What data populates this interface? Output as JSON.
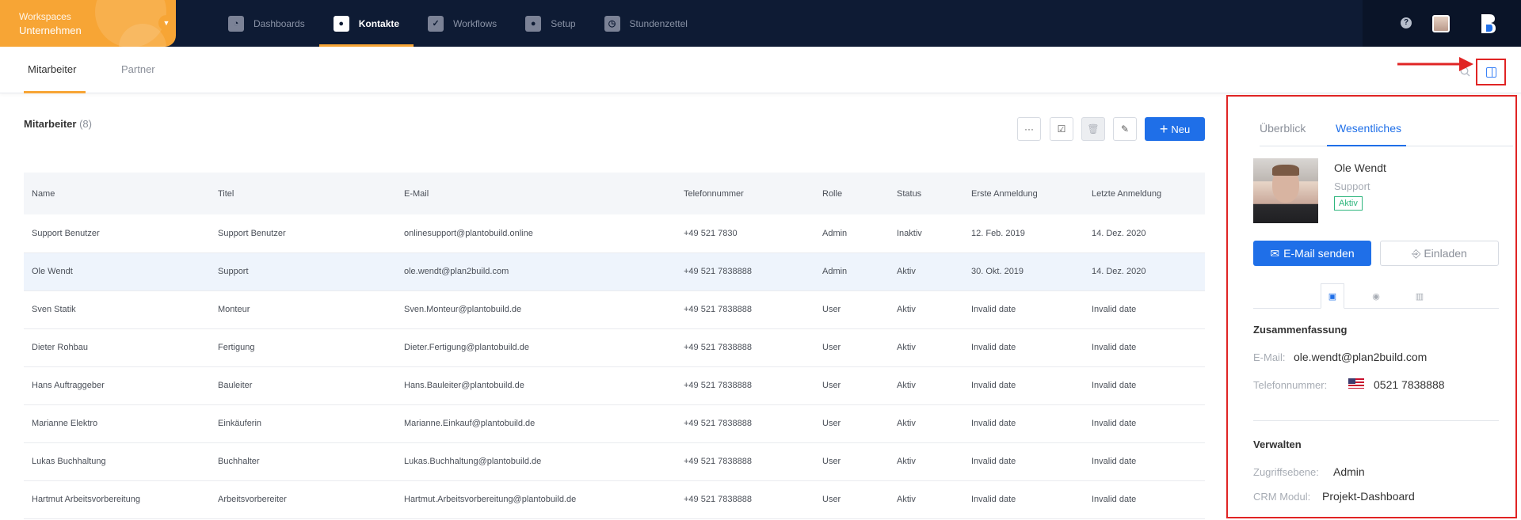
{
  "workspace": {
    "label": "Workspaces",
    "value": "Unternehmen"
  },
  "nav": [
    {
      "label": "Dashboards",
      "icon": "dashboard-icon"
    },
    {
      "label": "Kontakte",
      "icon": "contact-icon",
      "active": true
    },
    {
      "label": "Workflows",
      "icon": "workflow-icon"
    },
    {
      "label": "Setup",
      "icon": "setup-icon"
    },
    {
      "label": "Stundenzettel",
      "icon": "timesheet-icon"
    }
  ],
  "topbar": {
    "help": "?"
  },
  "tabs": {
    "mitarbeiter": "Mitarbeiter",
    "partner": "Partner"
  },
  "list": {
    "title": "Mitarbeiter",
    "count": "(8)",
    "new_label": "Neu",
    "columns": [
      "Name",
      "Titel",
      "E-Mail",
      "Telefonnummer",
      "Rolle",
      "Status",
      "Erste Anmeldung",
      "Letzte Anmeldung"
    ],
    "rows": [
      [
        "Support Benutzer",
        "Support Benutzer",
        "onlinesupport@plantobuild.online",
        "+49 521 7830",
        "Admin",
        "Inaktiv",
        "12. Feb. 2019",
        "14. Dez. 2020"
      ],
      [
        "Ole Wendt",
        "Support",
        "ole.wendt@plan2build.com",
        "+49 521 7838888",
        "Admin",
        "Aktiv",
        "30. Okt. 2019",
        "14. Dez. 2020"
      ],
      [
        "Sven Statik",
        "Monteur",
        "Sven.Monteur@plantobuild.de",
        "+49 521 7838888",
        "User",
        "Aktiv",
        "Invalid date",
        "Invalid date"
      ],
      [
        "Dieter Rohbau",
        "Fertigung",
        "Dieter.Fertigung@plantobuild.de",
        "+49 521 7838888",
        "User",
        "Aktiv",
        "Invalid date",
        "Invalid date"
      ],
      [
        "Hans Auftraggeber",
        "Bauleiter",
        "Hans.Bauleiter@plantobuild.de",
        "+49 521 7838888",
        "User",
        "Aktiv",
        "Invalid date",
        "Invalid date"
      ],
      [
        "Marianne Elektro",
        "Einkäuferin",
        "Marianne.Einkauf@plantobuild.de",
        "+49 521 7838888",
        "User",
        "Aktiv",
        "Invalid date",
        "Invalid date"
      ],
      [
        "Lukas Buchhaltung",
        "Buchhalter",
        "Lukas.Buchhaltung@plantobuild.de",
        "+49 521 7838888",
        "User",
        "Aktiv",
        "Invalid date",
        "Invalid date"
      ],
      [
        "Hartmut Arbeitsvorbereitung",
        "Arbeitsvorbereiter",
        "Hartmut.Arbeitsvorbereitung@plantobuild.de",
        "+49 521 7838888",
        "User",
        "Aktiv",
        "Invalid date",
        "Invalid date"
      ]
    ],
    "selected_row": 1
  },
  "side": {
    "tab_overview": "Überblick",
    "tab_essentials": "Wesentliches",
    "name": "Ole Wendt",
    "role": "Support",
    "status": "Aktiv",
    "mail_btn": "E-Mail senden",
    "invite_btn": "Einladen",
    "summary_title": "Zusammenfassung",
    "email_label": "E-Mail:",
    "email_value": "ole.wendt@plan2build.com",
    "phone_label": "Telefonnummer:",
    "phone_value": "0521 7838888",
    "manage_title": "Verwalten",
    "access_label": "Zugriffsebene:",
    "access_value": "Admin",
    "crm_label": "CRM Modul:",
    "crm_value": "Projekt-Dashboard"
  },
  "colors": {
    "accent": "#1f6fe8",
    "orange": "#f7a535",
    "navy": "#0e1b34",
    "highlight": "#e02424",
    "active_green": "#2eb67d"
  }
}
